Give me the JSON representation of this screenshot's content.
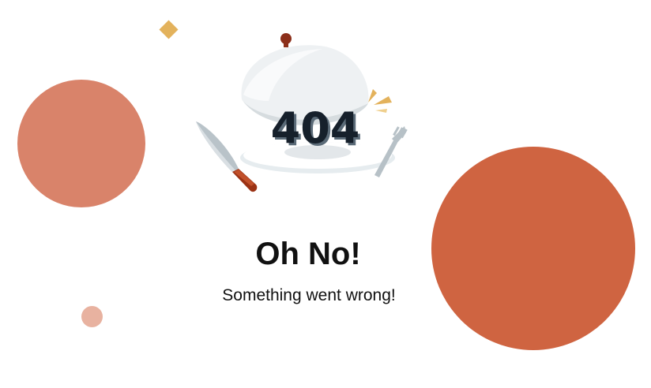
{
  "error": {
    "code": "404",
    "heading": "Oh No!",
    "message": "Something went wrong!"
  },
  "illustration": {
    "icons": [
      "cloche-icon",
      "knife-icon",
      "fork-icon",
      "sparkle-icon"
    ]
  },
  "colors": {
    "large_circle_right": "#cf6441",
    "circle_left": "#d9836a",
    "small_circle": "#e8b2a0",
    "diamond": "#e3b25c",
    "text": "#111111",
    "code_text": "#16202b"
  }
}
